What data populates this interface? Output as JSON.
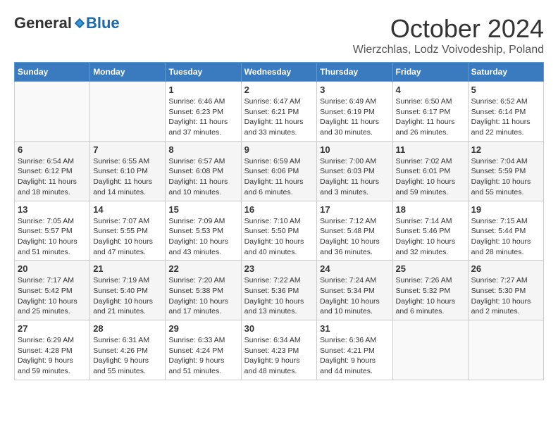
{
  "header": {
    "logo_general": "General",
    "logo_blue": "Blue",
    "month_title": "October 2024",
    "location": "Wierzchlas, Lodz Voivodeship, Poland"
  },
  "weekdays": [
    "Sunday",
    "Monday",
    "Tuesday",
    "Wednesday",
    "Thursday",
    "Friday",
    "Saturday"
  ],
  "weeks": [
    [
      {
        "day": "",
        "sunrise": "",
        "sunset": "",
        "daylight": ""
      },
      {
        "day": "",
        "sunrise": "",
        "sunset": "",
        "daylight": ""
      },
      {
        "day": "1",
        "sunrise": "Sunrise: 6:46 AM",
        "sunset": "Sunset: 6:23 PM",
        "daylight": "Daylight: 11 hours and 37 minutes."
      },
      {
        "day": "2",
        "sunrise": "Sunrise: 6:47 AM",
        "sunset": "Sunset: 6:21 PM",
        "daylight": "Daylight: 11 hours and 33 minutes."
      },
      {
        "day": "3",
        "sunrise": "Sunrise: 6:49 AM",
        "sunset": "Sunset: 6:19 PM",
        "daylight": "Daylight: 11 hours and 30 minutes."
      },
      {
        "day": "4",
        "sunrise": "Sunrise: 6:50 AM",
        "sunset": "Sunset: 6:17 PM",
        "daylight": "Daylight: 11 hours and 26 minutes."
      },
      {
        "day": "5",
        "sunrise": "Sunrise: 6:52 AM",
        "sunset": "Sunset: 6:14 PM",
        "daylight": "Daylight: 11 hours and 22 minutes."
      }
    ],
    [
      {
        "day": "6",
        "sunrise": "Sunrise: 6:54 AM",
        "sunset": "Sunset: 6:12 PM",
        "daylight": "Daylight: 11 hours and 18 minutes."
      },
      {
        "day": "7",
        "sunrise": "Sunrise: 6:55 AM",
        "sunset": "Sunset: 6:10 PM",
        "daylight": "Daylight: 11 hours and 14 minutes."
      },
      {
        "day": "8",
        "sunrise": "Sunrise: 6:57 AM",
        "sunset": "Sunset: 6:08 PM",
        "daylight": "Daylight: 11 hours and 10 minutes."
      },
      {
        "day": "9",
        "sunrise": "Sunrise: 6:59 AM",
        "sunset": "Sunset: 6:06 PM",
        "daylight": "Daylight: 11 hours and 6 minutes."
      },
      {
        "day": "10",
        "sunrise": "Sunrise: 7:00 AM",
        "sunset": "Sunset: 6:03 PM",
        "daylight": "Daylight: 11 hours and 3 minutes."
      },
      {
        "day": "11",
        "sunrise": "Sunrise: 7:02 AM",
        "sunset": "Sunset: 6:01 PM",
        "daylight": "Daylight: 10 hours and 59 minutes."
      },
      {
        "day": "12",
        "sunrise": "Sunrise: 7:04 AM",
        "sunset": "Sunset: 5:59 PM",
        "daylight": "Daylight: 10 hours and 55 minutes."
      }
    ],
    [
      {
        "day": "13",
        "sunrise": "Sunrise: 7:05 AM",
        "sunset": "Sunset: 5:57 PM",
        "daylight": "Daylight: 10 hours and 51 minutes."
      },
      {
        "day": "14",
        "sunrise": "Sunrise: 7:07 AM",
        "sunset": "Sunset: 5:55 PM",
        "daylight": "Daylight: 10 hours and 47 minutes."
      },
      {
        "day": "15",
        "sunrise": "Sunrise: 7:09 AM",
        "sunset": "Sunset: 5:53 PM",
        "daylight": "Daylight: 10 hours and 43 minutes."
      },
      {
        "day": "16",
        "sunrise": "Sunrise: 7:10 AM",
        "sunset": "Sunset: 5:50 PM",
        "daylight": "Daylight: 10 hours and 40 minutes."
      },
      {
        "day": "17",
        "sunrise": "Sunrise: 7:12 AM",
        "sunset": "Sunset: 5:48 PM",
        "daylight": "Daylight: 10 hours and 36 minutes."
      },
      {
        "day": "18",
        "sunrise": "Sunrise: 7:14 AM",
        "sunset": "Sunset: 5:46 PM",
        "daylight": "Daylight: 10 hours and 32 minutes."
      },
      {
        "day": "19",
        "sunrise": "Sunrise: 7:15 AM",
        "sunset": "Sunset: 5:44 PM",
        "daylight": "Daylight: 10 hours and 28 minutes."
      }
    ],
    [
      {
        "day": "20",
        "sunrise": "Sunrise: 7:17 AM",
        "sunset": "Sunset: 5:42 PM",
        "daylight": "Daylight: 10 hours and 25 minutes."
      },
      {
        "day": "21",
        "sunrise": "Sunrise: 7:19 AM",
        "sunset": "Sunset: 5:40 PM",
        "daylight": "Daylight: 10 hours and 21 minutes."
      },
      {
        "day": "22",
        "sunrise": "Sunrise: 7:20 AM",
        "sunset": "Sunset: 5:38 PM",
        "daylight": "Daylight: 10 hours and 17 minutes."
      },
      {
        "day": "23",
        "sunrise": "Sunrise: 7:22 AM",
        "sunset": "Sunset: 5:36 PM",
        "daylight": "Daylight: 10 hours and 13 minutes."
      },
      {
        "day": "24",
        "sunrise": "Sunrise: 7:24 AM",
        "sunset": "Sunset: 5:34 PM",
        "daylight": "Daylight: 10 hours and 10 minutes."
      },
      {
        "day": "25",
        "sunrise": "Sunrise: 7:26 AM",
        "sunset": "Sunset: 5:32 PM",
        "daylight": "Daylight: 10 hours and 6 minutes."
      },
      {
        "day": "26",
        "sunrise": "Sunrise: 7:27 AM",
        "sunset": "Sunset: 5:30 PM",
        "daylight": "Daylight: 10 hours and 2 minutes."
      }
    ],
    [
      {
        "day": "27",
        "sunrise": "Sunrise: 6:29 AM",
        "sunset": "Sunset: 4:28 PM",
        "daylight": "Daylight: 9 hours and 59 minutes."
      },
      {
        "day": "28",
        "sunrise": "Sunrise: 6:31 AM",
        "sunset": "Sunset: 4:26 PM",
        "daylight": "Daylight: 9 hours and 55 minutes."
      },
      {
        "day": "29",
        "sunrise": "Sunrise: 6:33 AM",
        "sunset": "Sunset: 4:24 PM",
        "daylight": "Daylight: 9 hours and 51 minutes."
      },
      {
        "day": "30",
        "sunrise": "Sunrise: 6:34 AM",
        "sunset": "Sunset: 4:23 PM",
        "daylight": "Daylight: 9 hours and 48 minutes."
      },
      {
        "day": "31",
        "sunrise": "Sunrise: 6:36 AM",
        "sunset": "Sunset: 4:21 PM",
        "daylight": "Daylight: 9 hours and 44 minutes."
      },
      {
        "day": "",
        "sunrise": "",
        "sunset": "",
        "daylight": ""
      },
      {
        "day": "",
        "sunrise": "",
        "sunset": "",
        "daylight": ""
      }
    ]
  ]
}
